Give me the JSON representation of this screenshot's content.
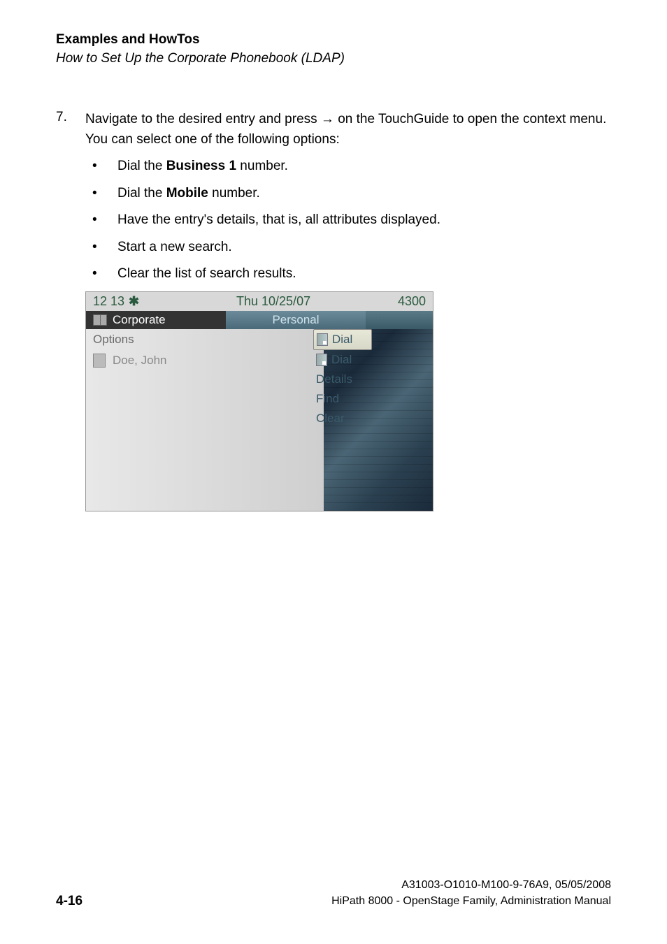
{
  "header": {
    "title": "Examples and HowTos",
    "subtitle": "How to Set Up the Corporate Phonebook (LDAP)"
  },
  "step": {
    "number": "7.",
    "text_before": "Navigate to the desired entry and press ",
    "arrow": "→",
    "text_after": " on the TouchGuide to open the context menu. You can select one of the following options:"
  },
  "bullets": [
    {
      "prefix": "Dial the ",
      "bold": "Business 1",
      "suffix": " number."
    },
    {
      "prefix": "Dial the ",
      "bold": "Mobile",
      "suffix": " number."
    },
    {
      "prefix": "Have the entry's details, that is, all attributes displayed.",
      "bold": "",
      "suffix": ""
    },
    {
      "prefix": "Start a new search.",
      "bold": "",
      "suffix": ""
    },
    {
      "prefix": "Clear the list of search results.",
      "bold": "",
      "suffix": ""
    }
  ],
  "phone": {
    "status": {
      "time": "12 13",
      "bt": "✱",
      "date": "Thu 10/25/07",
      "ext": "4300"
    },
    "tabs": {
      "active": "Corporate",
      "inactive": "Personal"
    },
    "rows": {
      "options": "Options",
      "entry": "Doe, John"
    },
    "menu": {
      "item1": "Dial",
      "item2": "Dial",
      "item3": "Details",
      "item4": "Find",
      "item5": "Clear"
    }
  },
  "footer": {
    "page": "4-16",
    "doc_id": "A31003-O1010-M100-9-76A9, 05/05/2008",
    "manual": "HiPath 8000 - OpenStage Family, Administration Manual"
  }
}
